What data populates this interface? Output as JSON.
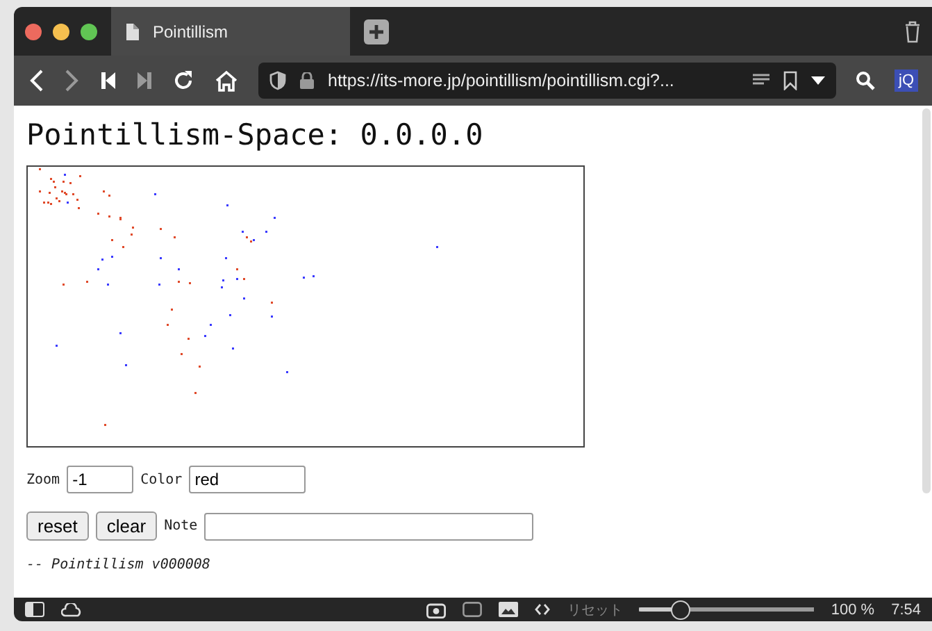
{
  "tab": {
    "title": "Pointillism"
  },
  "address_bar": {
    "url": "https://its-more.jp/pointillism/pointillism.cgi?..."
  },
  "extension": {
    "label": "jQ"
  },
  "page": {
    "heading": "Pointillism-Space: 0.0.0.0",
    "zoom": {
      "label": "Zoom",
      "value": "-1"
    },
    "color": {
      "label": "Color",
      "value": "red"
    },
    "buttons": [
      "reset",
      "clear"
    ],
    "note": {
      "label": "Note"
    },
    "footer": "-- Pointillism v000008"
  },
  "status_bar": {
    "reset_label": "リセット",
    "zoom_slider": {
      "level": 0.2
    },
    "zoom_text": "100 %",
    "time": "7:54"
  }
}
